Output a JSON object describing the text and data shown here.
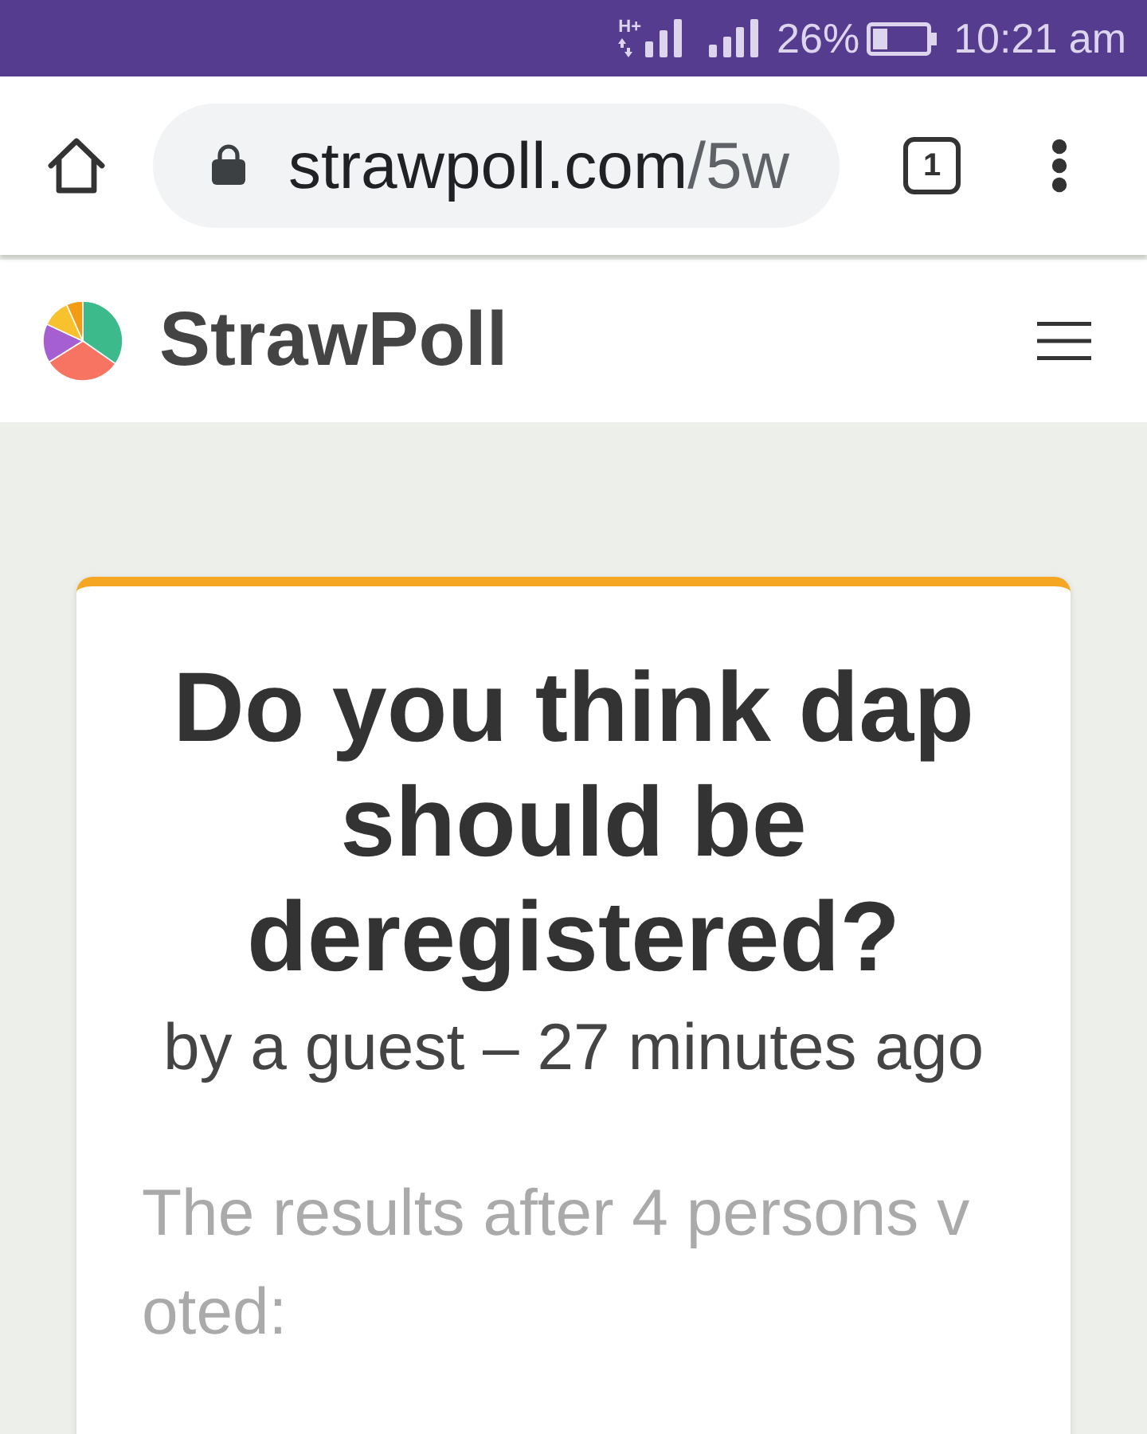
{
  "status_bar": {
    "network_type": "H+",
    "battery": "26%",
    "time": "10:21 am"
  },
  "browser": {
    "url": {
      "host": "strawpoll.com",
      "path": "/5w"
    },
    "tab_count": "1"
  },
  "site_header": {
    "logo_text": "StrawPoll"
  },
  "poll": {
    "question": "Do you think dap should be deregistered?",
    "byline": "by a guest – 27 minutes ago",
    "results_intro": "The results after 4 persons voted:"
  }
}
